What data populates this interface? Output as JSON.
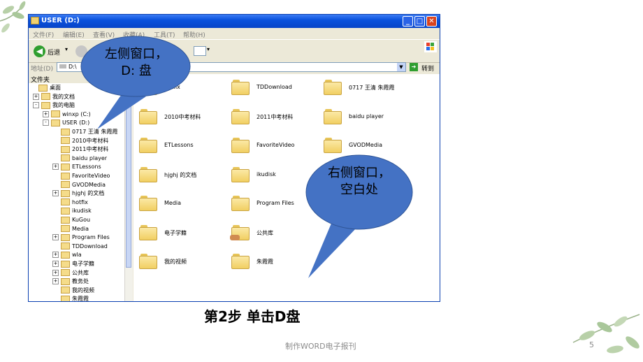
{
  "window": {
    "title": "USER (D:)",
    "menu": [
      "文件(F)",
      "编辑(E)",
      "查看(V)",
      "收藏(A)",
      "工具(T)",
      "帮助(H)"
    ],
    "back_label": "后退",
    "address_label": "地址(D)",
    "address_value": "D:\\",
    "go_label": "转到",
    "folders_header": "文件夹"
  },
  "tree": [
    {
      "label": "桌面",
      "level": 0,
      "expander": ""
    },
    {
      "label": "我的文档",
      "level": 1,
      "expander": "+"
    },
    {
      "label": "我的电脑",
      "level": 1,
      "expander": "-"
    },
    {
      "label": "winxp (C:)",
      "level": 2,
      "expander": "+"
    },
    {
      "label": "USER (D:)",
      "level": 2,
      "expander": "-"
    },
    {
      "label": "0717 王清 朱霞霞",
      "level": 3,
      "expander": ""
    },
    {
      "label": "2010中考材料",
      "level": 3,
      "expander": ""
    },
    {
      "label": "2011中考材料",
      "level": 3,
      "expander": ""
    },
    {
      "label": "baidu player",
      "level": 3,
      "expander": ""
    },
    {
      "label": "ETLessons",
      "level": 3,
      "expander": "+"
    },
    {
      "label": "FavoriteVideo",
      "level": 3,
      "expander": ""
    },
    {
      "label": "GVODMedia",
      "level": 3,
      "expander": ""
    },
    {
      "label": "hjghj 的文档",
      "level": 3,
      "expander": "+"
    },
    {
      "label": "hotfix",
      "level": 3,
      "expander": ""
    },
    {
      "label": "ikudisk",
      "level": 3,
      "expander": ""
    },
    {
      "label": "KuGou",
      "level": 3,
      "expander": ""
    },
    {
      "label": "Media",
      "level": 3,
      "expander": ""
    },
    {
      "label": "Program Files",
      "level": 3,
      "expander": "+"
    },
    {
      "label": "TDDownload",
      "level": 3,
      "expander": ""
    },
    {
      "label": "wla",
      "level": 3,
      "expander": "+"
    },
    {
      "label": "电子学籍",
      "level": 3,
      "expander": "+"
    },
    {
      "label": "公共库",
      "level": 3,
      "expander": "+"
    },
    {
      "label": "教务处",
      "level": 3,
      "expander": "+"
    },
    {
      "label": "我的视频",
      "level": 3,
      "expander": ""
    },
    {
      "label": "朱霞霞",
      "level": 3,
      "expander": ""
    }
  ],
  "files": [
    {
      "label": "hotfix",
      "col": 0,
      "row": 0
    },
    {
      "label": "TDDownload",
      "col": 1,
      "row": 0
    },
    {
      "label": "0717 王清 朱霞霞",
      "col": 2,
      "row": 0
    },
    {
      "label": "2010中考材料",
      "col": 0,
      "row": 1
    },
    {
      "label": "2011中考材料",
      "col": 1,
      "row": 1
    },
    {
      "label": "baidu player",
      "col": 2,
      "row": 1
    },
    {
      "label": "ETLessons",
      "col": 0,
      "row": 2
    },
    {
      "label": "FavoriteVideo",
      "col": 1,
      "row": 2
    },
    {
      "label": "GVODMedia",
      "col": 2,
      "row": 2
    },
    {
      "label": "hjghj 的文档",
      "col": 0,
      "row": 3
    },
    {
      "label": "ikudisk",
      "col": 1,
      "row": 3
    },
    {
      "label": "Media",
      "col": 0,
      "row": 4
    },
    {
      "label": "Program Files",
      "col": 1,
      "row": 4
    },
    {
      "label": "电子学籍",
      "col": 0,
      "row": 5
    },
    {
      "label": "公共库",
      "col": 1,
      "row": 5,
      "shared": true
    },
    {
      "label": "我的视频",
      "col": 0,
      "row": 6
    },
    {
      "label": "朱霞霞",
      "col": 1,
      "row": 6
    }
  ],
  "callouts": {
    "left_line1": "左侧窗口，",
    "left_line2": "D:  盘",
    "right_line1": "右侧窗口，",
    "right_line2": "空白处"
  },
  "caption": "第2步   单击D盘",
  "footer": "制作WORD电子报刊",
  "page_number": "5",
  "colors": {
    "callout_fill": "#4472c4",
    "titlebar": "#0a52dd"
  }
}
